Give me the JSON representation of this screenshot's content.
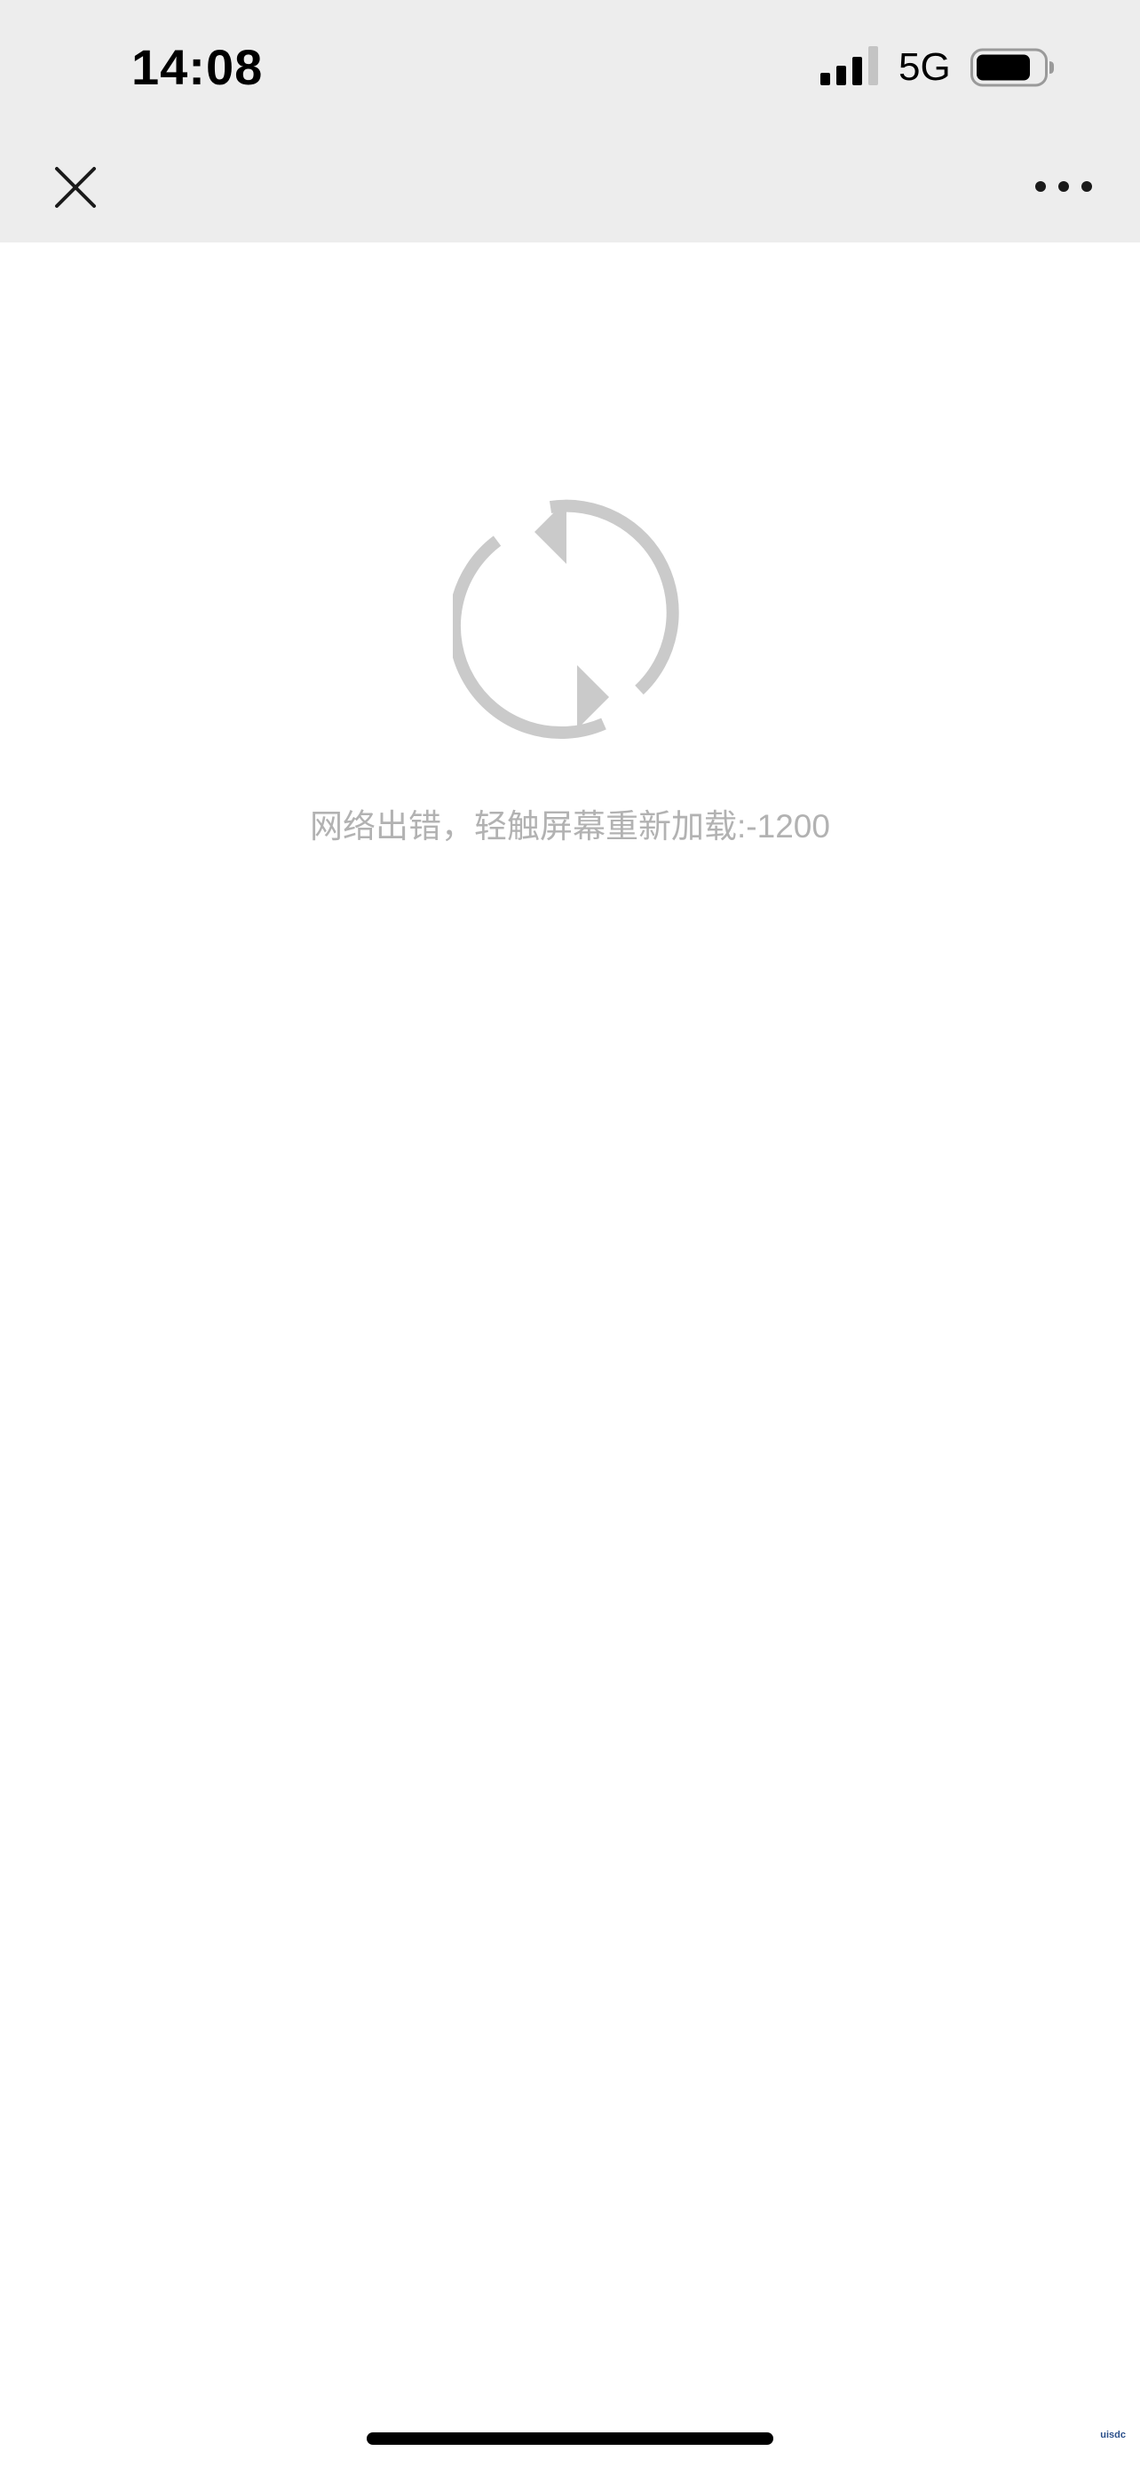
{
  "status_bar": {
    "time": "14:08",
    "network": "5G",
    "signal_icon": "cellular-signal-icon",
    "battery_icon": "battery-icon"
  },
  "nav_bar": {
    "close_icon": "close-icon",
    "more_icon": "more-horizontal-icon"
  },
  "error": {
    "icon": "reload-icon",
    "message": "网络出错，轻触屏幕重新加载:-1200"
  },
  "colors": {
    "top_background": "#ededed",
    "page_background": "#ffffff",
    "icon_gray": "#cacaca",
    "message_gray": "#b2b2b2"
  },
  "watermark": "uisdc"
}
